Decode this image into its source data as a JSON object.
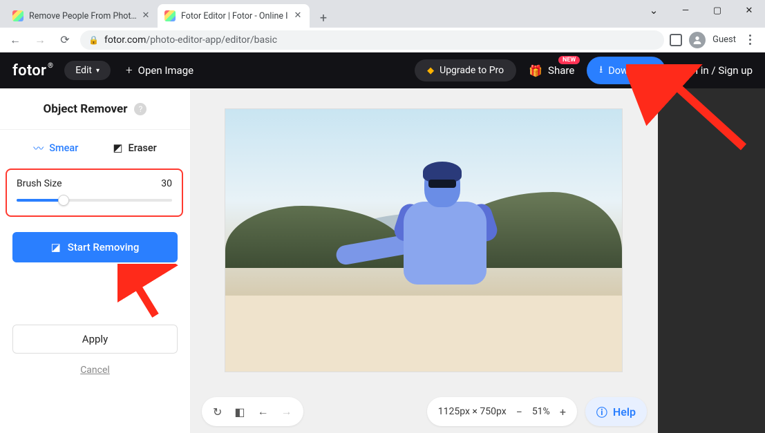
{
  "browser": {
    "tabs": [
      {
        "title": "Remove People From Photos C"
      },
      {
        "title": "Fotor Editor | Fotor - Online I"
      }
    ],
    "url_domain": "fotor.com",
    "url_path": "/photo-editor-app/editor/basic",
    "guest_label": "Guest"
  },
  "header": {
    "logo": "fotor",
    "edit_label": "Edit",
    "open_image_label": "Open Image",
    "upgrade_label": "Upgrade to Pro",
    "share_label": "Share",
    "share_badge": "NEW",
    "download_label": "Download",
    "signin_label": "Sign in",
    "signup_label": "Sign up",
    "auth_sep": " / "
  },
  "sidebar": {
    "title": "Object Remover",
    "tabs": {
      "smear": "Smear",
      "eraser": "Eraser"
    },
    "brush": {
      "label": "Brush Size",
      "value": "30",
      "percent": 30
    },
    "start_label": "Start Removing",
    "apply_label": "Apply",
    "cancel_label": "Cancel"
  },
  "canvas": {
    "dimensions_label": "1125px × 750px",
    "zoom_label": "51%",
    "help_label": "Help"
  }
}
